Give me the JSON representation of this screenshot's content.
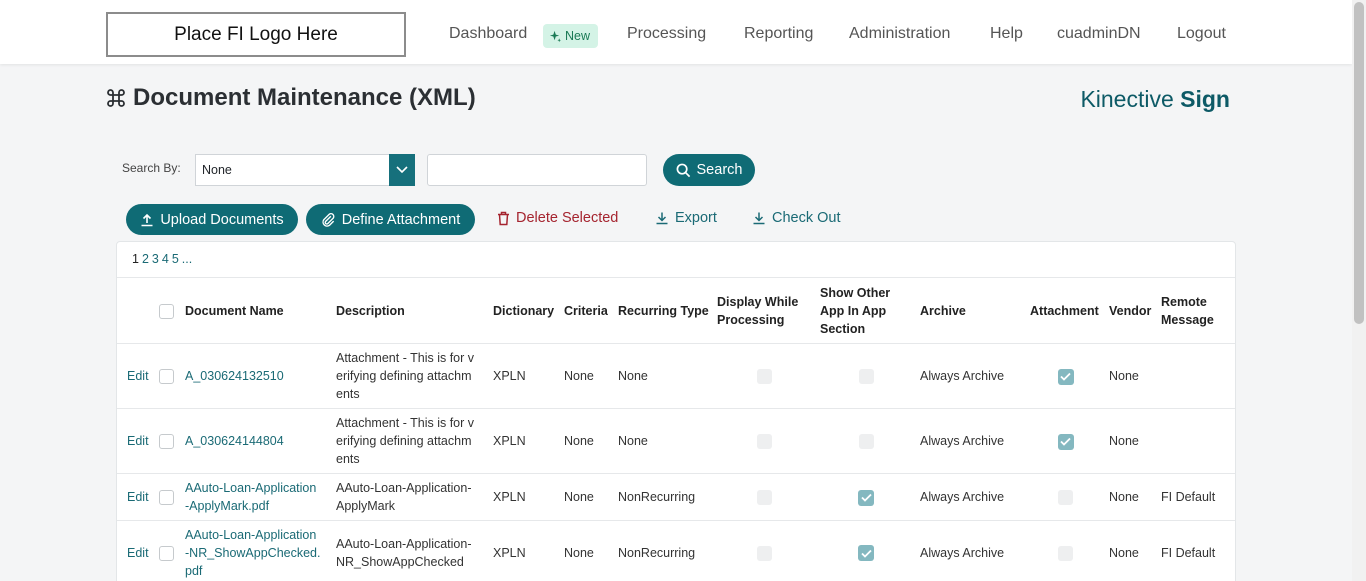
{
  "nav": {
    "logo_text": "Place FI Logo Here",
    "dashboard": "Dashboard",
    "new_badge": "New",
    "processing": "Processing",
    "reporting": "Reporting",
    "administration": "Administration",
    "help": "Help",
    "user": "cuadminDN",
    "logout": "Logout"
  },
  "header": {
    "title": "Document Maintenance (XML)",
    "brand_light": "Kinective",
    "brand_bold": "Sign"
  },
  "search": {
    "label": "Search By:",
    "selected": "None",
    "query": "",
    "button": "Search"
  },
  "toolbar": {
    "upload": "Upload Documents",
    "define": "Define Attachment",
    "delete": "Delete Selected",
    "export": "Export",
    "checkout": "Check Out"
  },
  "pager": {
    "current": "1",
    "pages": [
      "2",
      "3",
      "4",
      "5",
      "..."
    ]
  },
  "columns": {
    "name": "Document Name",
    "description": "Description",
    "dictionary": "Dictionary",
    "criteria": "Criteria",
    "recurring": "Recurring Type",
    "display_a": "Display While",
    "display_b": "Processing",
    "show_a": "Show Other",
    "show_b": "App In App",
    "show_c": "Section",
    "archive": "Archive",
    "attachment": "Attachment",
    "vendor": "Vendor",
    "remote_a": "Remote",
    "remote_b": "Message"
  },
  "rows": [
    {
      "edit": "Edit",
      "name_a": "A_030624132510",
      "name_b": "",
      "name_c": "",
      "desc_a": "Attachment - This is for v",
      "desc_b": "erifying defining attachm",
      "desc_c": "ents",
      "dictionary": "XPLN",
      "criteria": "None",
      "recurring": "None",
      "display": false,
      "show_other": false,
      "archive": "Always Archive",
      "attachment": true,
      "vendor": "None",
      "remote": ""
    },
    {
      "edit": "Edit",
      "name_a": "A_030624144804",
      "name_b": "",
      "name_c": "",
      "desc_a": "Attachment - This is for v",
      "desc_b": "erifying defining attachm",
      "desc_c": "ents",
      "dictionary": "XPLN",
      "criteria": "None",
      "recurring": "None",
      "display": false,
      "show_other": false,
      "archive": "Always Archive",
      "attachment": true,
      "vendor": "None",
      "remote": ""
    },
    {
      "edit": "Edit",
      "name_a": "AAuto-Loan-Application",
      "name_b": "-ApplyMark.pdf",
      "name_c": "",
      "desc_a": "AAuto-Loan-Application-",
      "desc_b": "ApplyMark",
      "desc_c": "",
      "dictionary": "XPLN",
      "criteria": "None",
      "recurring": "NonRecurring",
      "display": false,
      "show_other": true,
      "archive": "Always Archive",
      "attachment": false,
      "vendor": "None",
      "remote": "FI Default"
    },
    {
      "edit": "Edit",
      "name_a": "AAuto-Loan-Application",
      "name_b": "-NR_ShowAppChecked.",
      "name_c": "pdf",
      "desc_a": "AAuto-Loan-Application-",
      "desc_b": "NR_ShowAppChecked",
      "desc_c": "",
      "dictionary": "XPLN",
      "criteria": "None",
      "recurring": "NonRecurring",
      "display": false,
      "show_other": true,
      "archive": "Always Archive",
      "attachment": false,
      "vendor": "None",
      "remote": "FI Default"
    }
  ]
}
